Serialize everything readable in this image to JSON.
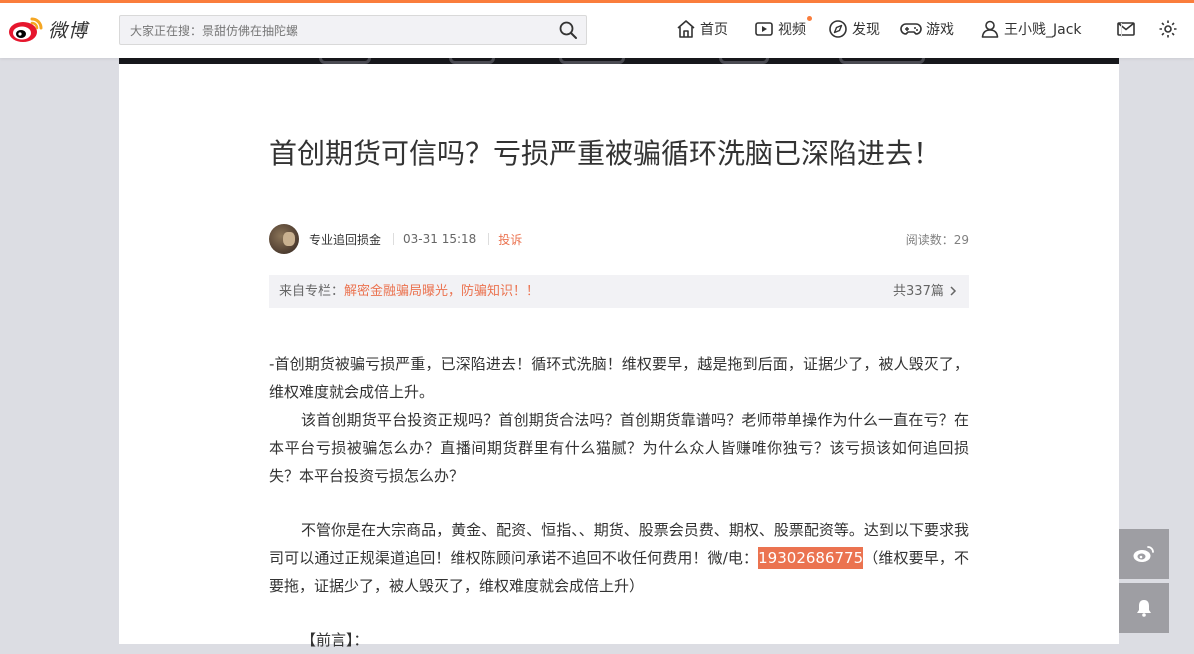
{
  "header": {
    "logo_text": "微博",
    "search_placeholder": "大家正在搜：景甜仿佛在抽陀螺",
    "nav": {
      "home": "首页",
      "video": "视频",
      "discover": "发现",
      "game": "游戏",
      "user": "王小贱_Jack"
    }
  },
  "article": {
    "title": "首创期货可信吗？亏损严重被骗循环洗脑已深陷进去！",
    "author": "专业追回损金",
    "date": "03-31 15:18",
    "report": "投诉",
    "read_count": "阅读数：29",
    "column_prefix": "来自专栏：",
    "column_name": "解密金融骗局曝光，防骗知识！！",
    "column_count": "共337篇",
    "para1": "-首创期货被骗亏损严重，已深陷进去！循环式洗脑！维权要早，越是拖到后面，证据少了，被人毁灭了，维权难度就会成倍上升。",
    "para2": "该首创期货平台投资正规吗？首创期货合法吗？首创期货靠谱吗？老师带单操作为什么一直在亏？在本平台亏损被骗怎么办？直播间期货群里有什么猫腻？为什么众人皆赚唯你独亏？该亏损该如何追回损失？本平台投资亏损怎么办？",
    "para3": "不管你是在大宗商品，黄金、配资、恒指、、期货、股票会员费、期权、股票配资等。达到以下要求我司可以通过正规渠道追回！维权陈顾问承诺不追回不收任何费用！微/电：",
    "phone": "19302686775",
    "para3_tail": "（维权要早，不要拖，证据少了，被人毁灭了，维权难度就会成倍上升）",
    "para4": "【前言】："
  },
  "colors": {
    "accent": "#fa7d3c",
    "link": "#eb7350",
    "text": "#333333",
    "page_bg": "#dcdde3",
    "side_button": "#9e9ea3"
  }
}
